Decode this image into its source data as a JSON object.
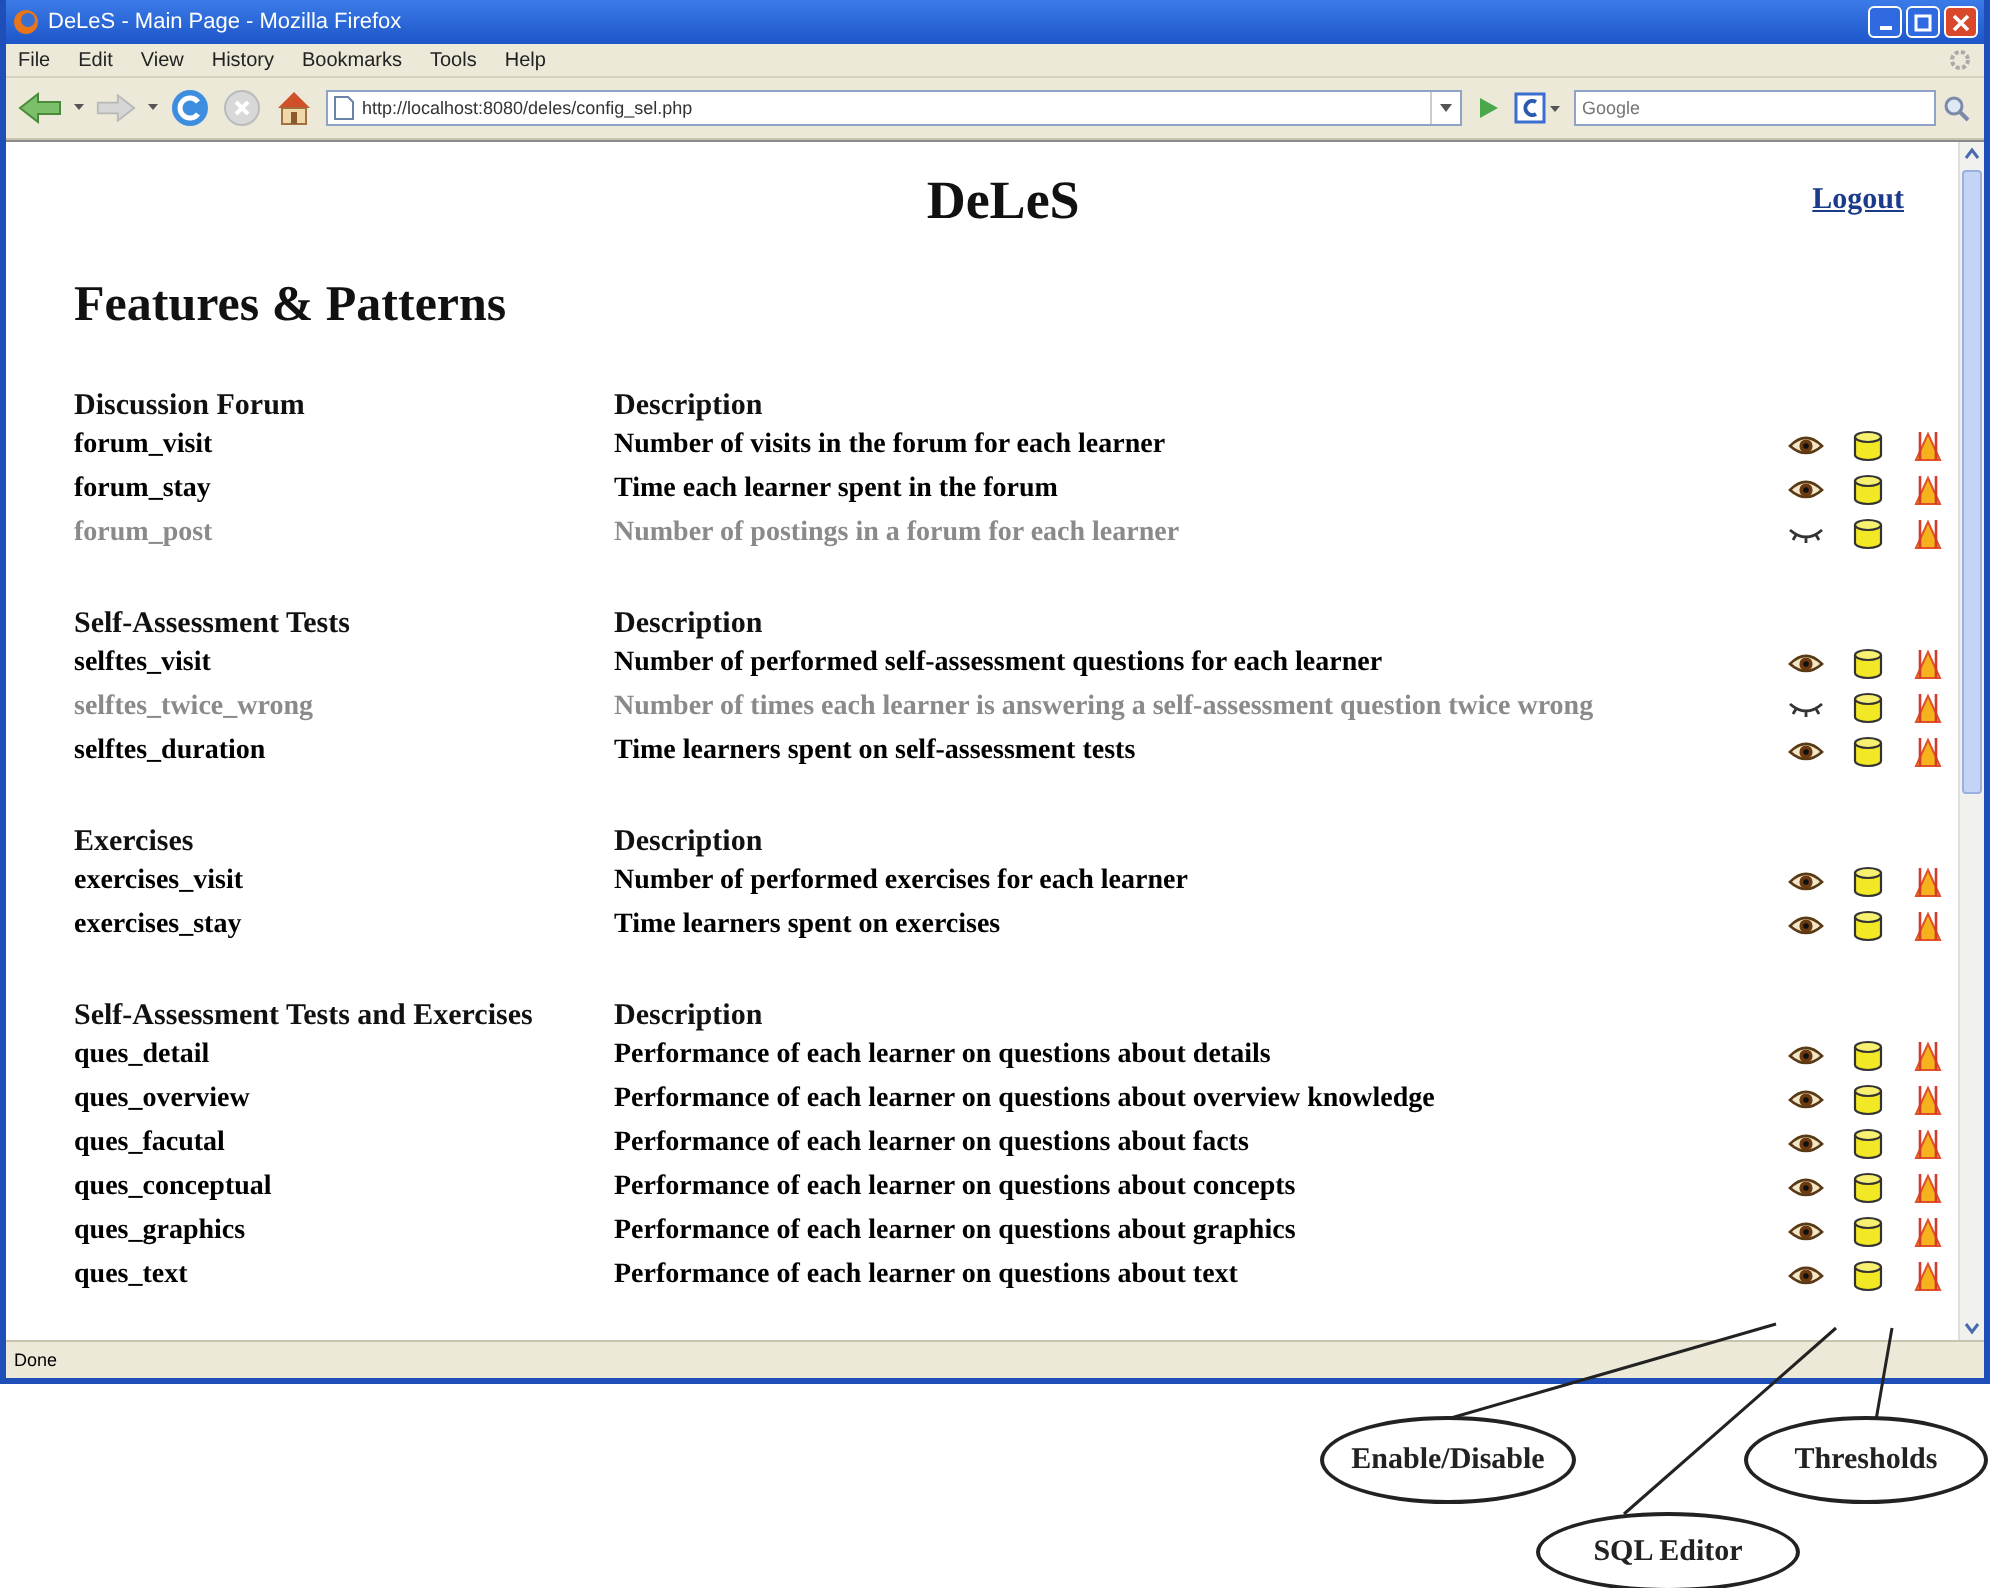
{
  "window": {
    "title": "DeLeS - Main Page - Mozilla Firefox"
  },
  "menu": [
    "File",
    "Edit",
    "View",
    "History",
    "Bookmarks",
    "Tools",
    "Help"
  ],
  "address": {
    "value": "http://localhost:8080/deles/config_sel.php"
  },
  "search": {
    "placeholder": "Google"
  },
  "page": {
    "site_title": "DeLeS",
    "logout": "Logout",
    "heading": "Features & Patterns"
  },
  "sections": [
    {
      "title": "Discussion Forum",
      "description_heading": "Description",
      "rows": [
        {
          "name": "forum_visit",
          "description": "Number of visits in the forum for each learner",
          "enabled": true
        },
        {
          "name": "forum_stay",
          "description": "Time each learner spent in the forum",
          "enabled": true
        },
        {
          "name": "forum_post",
          "description": "Number of postings in a forum for each learner",
          "enabled": false
        }
      ]
    },
    {
      "title": "Self-Assessment Tests",
      "description_heading": "Description",
      "rows": [
        {
          "name": "selftes_visit",
          "description": "Number of performed self-assessment questions for each learner",
          "enabled": true
        },
        {
          "name": "selftes_twice_wrong",
          "description": "Number of times each learner is answering a self-assessment question twice wrong",
          "enabled": false
        },
        {
          "name": "selftes_duration",
          "description": "Time learners spent on self-assessment tests",
          "enabled": true
        }
      ]
    },
    {
      "title": "Exercises",
      "description_heading": "Description",
      "rows": [
        {
          "name": "exercises_visit",
          "description": "Number of performed exercises for each learner",
          "enabled": true
        },
        {
          "name": "exercises_stay",
          "description": "Time learners spent on exercises",
          "enabled": true
        }
      ]
    },
    {
      "title": "Self-Assessment Tests and Exercises",
      "description_heading": "Description",
      "rows": [
        {
          "name": "ques_detail",
          "description": "Performance of each learner on questions about details",
          "enabled": true
        },
        {
          "name": "ques_overview",
          "description": "Performance of each learner on questions about overview knowledge",
          "enabled": true
        },
        {
          "name": "ques_facutal",
          "description": "Performance of each learner on questions about facts",
          "enabled": true
        },
        {
          "name": "ques_conceptual",
          "description": "Performance of each learner on questions about concepts",
          "enabled": true
        },
        {
          "name": "ques_graphics",
          "description": "Performance of each learner on questions about graphics",
          "enabled": true
        },
        {
          "name": "ques_text",
          "description": "Performance of each learner on questions about text",
          "enabled": true
        }
      ]
    }
  ],
  "status_bar": "Done",
  "annotations": [
    {
      "label": "Enable/Disable"
    },
    {
      "label": "SQL Editor"
    },
    {
      "label": "Thresholds"
    }
  ]
}
